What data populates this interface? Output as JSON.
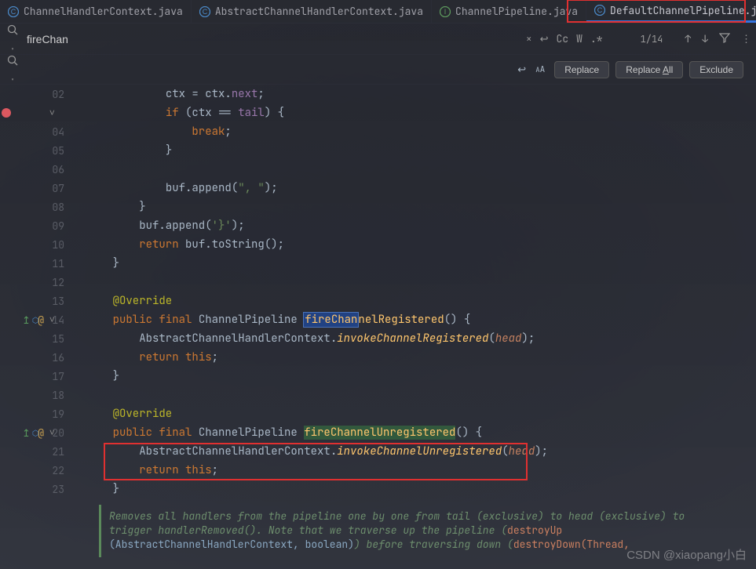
{
  "tabs": [
    {
      "icon": "class",
      "label": "ChannelHandlerContext.java",
      "active": false
    },
    {
      "icon": "class",
      "label": "AbstractChannelHandlerContext.java",
      "active": false
    },
    {
      "icon": "interface",
      "label": "ChannelPipeline.java",
      "active": false
    },
    {
      "icon": "class",
      "label": "DefaultChannelPipeline.java",
      "active": true
    }
  ],
  "search": {
    "query": "fireChan",
    "count": "1/14",
    "options": {
      "cc": "Cc",
      "word": "W",
      "regex": ".*"
    }
  },
  "replace": {
    "buttons": {
      "replace": "Replace",
      "replaceAll_prefix": "Replace ",
      "replaceAll_u": "A",
      "replaceAll_suffix": "ll",
      "exclude": "Exclude"
    },
    "tools": {
      "preserve_case": "↩",
      "case_size": "AA"
    }
  },
  "gutter": {
    "start": 2,
    "end": 23
  },
  "code": {
    "l02": {
      "indent": "            ",
      "t1": "ctx = ctx.",
      "f": "next",
      "t2": ";"
    },
    "l03": {
      "indent": "            ",
      "k1": "if ",
      "t1": "(ctx == ",
      "f": "tail",
      "t2": ") {"
    },
    "l04": {
      "indent": "                ",
      "k1": "break",
      "t1": ";"
    },
    "l05": {
      "indent": "            ",
      "t1": "}"
    },
    "l06": {
      "indent": ""
    },
    "l07": {
      "indent": "            ",
      "t1": "buf.append(",
      "s": "\", \"",
      "t2": ");"
    },
    "l08": {
      "indent": "        ",
      "t1": "}"
    },
    "l09": {
      "indent": "        ",
      "t1": "buf.append(",
      "s": "'}'",
      "t2": ");"
    },
    "l10": {
      "indent": "        ",
      "k1": "return ",
      "t1": "buf.toString();"
    },
    "l11": {
      "indent": "    ",
      "t1": "}"
    },
    "l12": {
      "indent": ""
    },
    "l13": {
      "indent": "    ",
      "a": "@Override"
    },
    "l14": {
      "indent": "    ",
      "k1": "public final ",
      "ty": "ChannelPipeline ",
      "match": "fireChan",
      "mrest": "nelRegistered",
      "t1": "() {"
    },
    "l15": {
      "indent": "        ",
      "ty": "AbstractChannelHandlerContext",
      "t1": ".",
      "m": "invokeChannelRegistered",
      "t2": "(",
      "p": "head",
      "t3": ");"
    },
    "l16": {
      "indent": "        ",
      "k1": "return ",
      "k2": "this",
      "t1": ";"
    },
    "l17": {
      "indent": "    ",
      "t1": "}"
    },
    "l18": {
      "indent": ""
    },
    "l19": {
      "indent": "    ",
      "a": "@Override"
    },
    "l20": {
      "indent": "    ",
      "k1": "public final ",
      "ty": "ChannelPipeline ",
      "m": "fireChannelUnregistered",
      "t1": "() {"
    },
    "l21": {
      "indent": "        ",
      "ty": "AbstractChannelHandlerContext",
      "t1": ".",
      "m": "invokeChannelUnregistered",
      "t2": "(",
      "p": "head",
      "t3": ");"
    },
    "l22": {
      "indent": "        ",
      "k1": "return ",
      "k2": "this",
      "t1": ";"
    },
    "l23": {
      "indent": "    ",
      "t1": "}"
    }
  },
  "doc": {
    "l1": "Removes all handlers from the pipeline one by one from tail (exclusive) to head (exclusive) to",
    "l2_a": "trigger handlerRemoved(). Note that we traverse up the pipeline (",
    "l2_b": "destroyUp",
    "l3_a": "(AbstractChannelHandlerContext, boolean)",
    "l3_b": ") before traversing down (",
    "l3_c": "destroyDown(Thread,"
  },
  "watermark": "CSDN @xiaopang小白"
}
